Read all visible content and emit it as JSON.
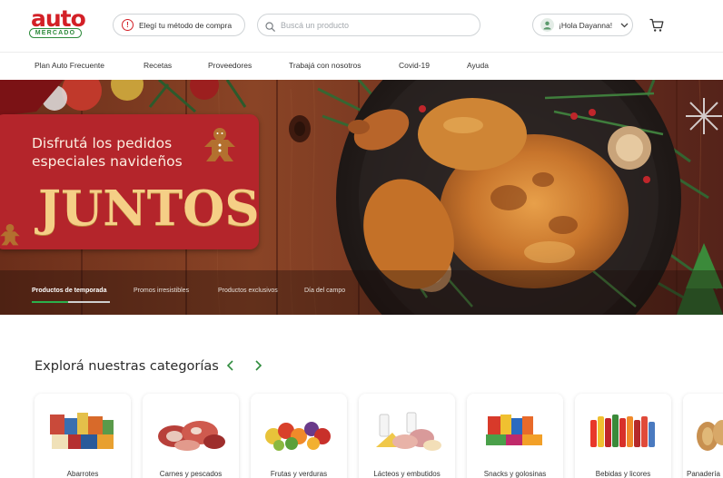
{
  "brand": {
    "logo_main": "auto",
    "logo_sub": "MERCADO",
    "accent": "#d32027",
    "green": "#2e8b3c"
  },
  "header": {
    "method_label": "Elegí tu método de compra",
    "search_placeholder": "Buscá un producto",
    "user_greeting": "¡Hola Dayanna!",
    "icons": [
      "alert-icon",
      "search-icon",
      "user-icon",
      "chevron-down-icon",
      "cart-icon"
    ]
  },
  "nav": {
    "items": [
      "Plan Auto Frecuente",
      "Recetas",
      "Proveedores",
      "Trabajá con nosotros",
      "Covid-19",
      "Ayuda"
    ]
  },
  "hero": {
    "subtitle": "Disfrutá los pedidos especiales navideños",
    "title": "JUNTOS",
    "tabs": [
      "Productos de temporada",
      "Promos irresistibles",
      "Productos exclusivos",
      "Día del campo"
    ],
    "active_tab": 0
  },
  "categories": {
    "title": "Explorá nuestras categorías",
    "items": [
      {
        "label": "Abarrotes"
      },
      {
        "label": "Carnes y pescados"
      },
      {
        "label": "Frutas y verduras"
      },
      {
        "label": "Lácteos y embutidos"
      },
      {
        "label": "Snacks y golosinas"
      },
      {
        "label": "Bebidas y licores"
      },
      {
        "label": "Panadería"
      }
    ]
  }
}
